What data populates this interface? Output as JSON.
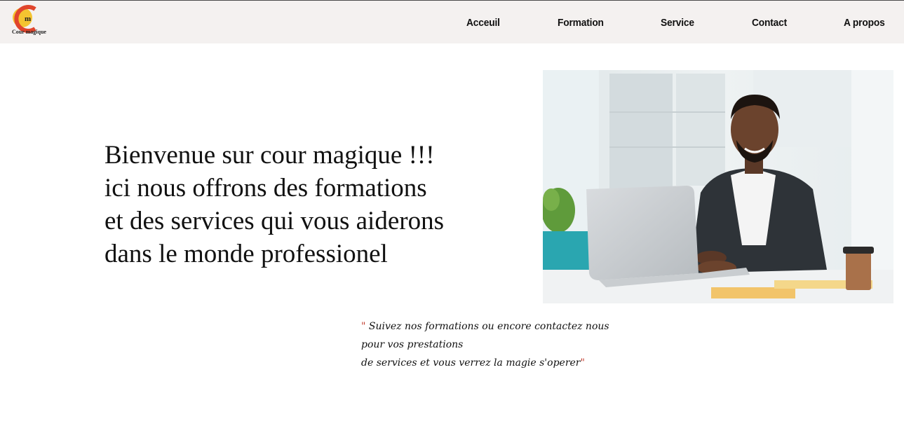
{
  "brand": {
    "logo_letter": "m",
    "name": "Cour magique"
  },
  "nav": {
    "items": [
      {
        "label": "Acceuil"
      },
      {
        "label": "Formation"
      },
      {
        "label": "Service"
      },
      {
        "label": "Contact"
      },
      {
        "label": "A propos"
      }
    ]
  },
  "hero": {
    "lines": [
      "Bienvenue sur cour magique !!!",
      "ici nous offrons des formations",
      "et des services qui vous aiderons",
      "dans le monde professionel"
    ],
    "image_icon": "man-at-laptop-photo"
  },
  "quote": {
    "open_mark": "\"",
    "line1": " Suivez nos formations ou encore contactez nous",
    "line2": "pour vos prestations",
    "line3": "de services et vous verrez la magie s'operer",
    "close_mark": "\""
  },
  "colors": {
    "navbar_bg": "#f4f1f0",
    "logo_yellow": "#f4c430",
    "logo_red": "#e0452c",
    "quote_mark": "#c0392b"
  }
}
